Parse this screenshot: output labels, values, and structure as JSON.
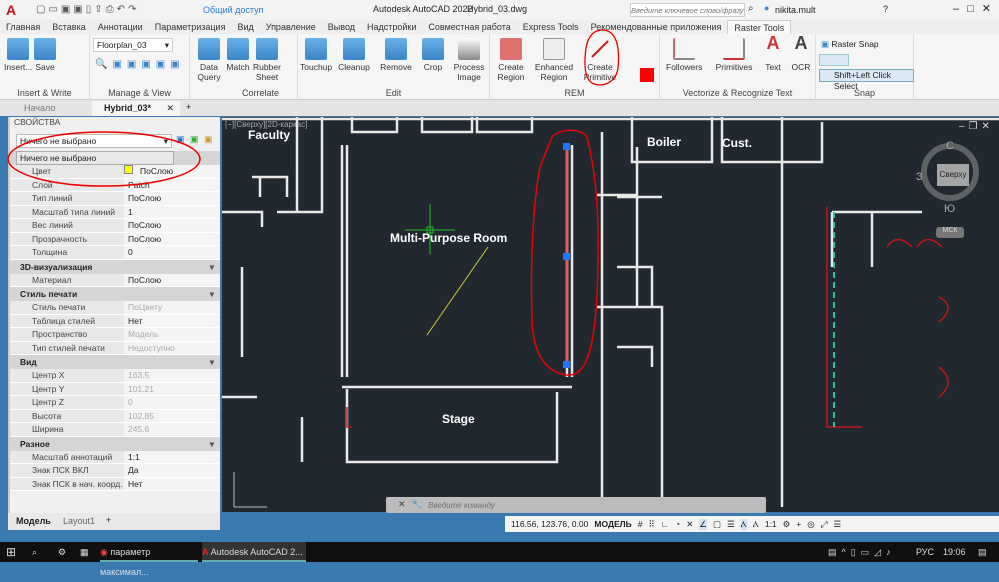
{
  "titlebar": {
    "app_title": "Autodesk AutoCAD 2022",
    "file": "Hybrid_03.dwg",
    "share": "Общий доступ",
    "search_placeholder": "Введите ключевое слово/фразу",
    "user": "nikita.mult"
  },
  "menu_tabs": [
    "Главная",
    "Вставка",
    "Аннотации",
    "Параметризация",
    "Вид",
    "Управление",
    "Вывод",
    "Надстройки",
    "Совместная работа",
    "Express Tools",
    "Рекомендованные приложения",
    "Raster Tools"
  ],
  "active_tab": "Raster Tools",
  "ribbon": {
    "insert_write": {
      "title": "Insert & Write",
      "insert": "Insert...",
      "save": "Save"
    },
    "manage_view": {
      "title": "Manage & View",
      "image_select": "Floorplan_03"
    },
    "data_query": "Data Query",
    "correlate": {
      "title": "Correlate",
      "match": "Match",
      "rubber_sheet": "Rubber Sheet"
    },
    "edit": {
      "title": "Edit",
      "touchup": "Touchup",
      "cleanup": "Cleanup",
      "remove": "Remove",
      "crop": "Crop",
      "process_image": "Process Image"
    },
    "rem": {
      "title": "REM",
      "create_region": "Create Region",
      "enhanced_region": "Enhanced Region",
      "create_primitive": "Create Primitive"
    },
    "vectorize": {
      "title": "Vectorize & Recognize Text",
      "followers": "Followers",
      "primitives": "Primitives",
      "text": "Text",
      "ocr": "OCR"
    },
    "snap": {
      "title": "Snap",
      "raster_snap": "Raster Snap",
      "shift_select": "Shift+Left Click Select"
    }
  },
  "doc_tabs": [
    "Начало",
    "Hybrid_03*"
  ],
  "properties": {
    "title": "СВОЙСТВА",
    "selection": "Ничего не выбрано",
    "dropdown_option": "Ничего не выбрано",
    "general": [
      {
        "k": "Цвет",
        "v": "ПоСлою"
      },
      {
        "k": "Слой",
        "v": "Patch"
      },
      {
        "k": "Тип линий",
        "v": "ПоСлою"
      },
      {
        "k": "Масштаб типа линий",
        "v": "1"
      },
      {
        "k": "Вес линий",
        "v": "ПоСлою"
      },
      {
        "k": "Прозрачность",
        "v": "ПоСлою"
      },
      {
        "k": "Толщина",
        "v": "0"
      }
    ],
    "viz_title": "3D-визуализация",
    "viz": [
      {
        "k": "Материал",
        "v": "ПоСлою"
      }
    ],
    "print_title": "Стиль печати",
    "print": [
      {
        "k": "Стиль печати",
        "v": "ПоЦвету"
      },
      {
        "k": "Таблица стилей печати",
        "v": "Нет"
      },
      {
        "k": "Пространство таблицы...",
        "v": "Модель"
      },
      {
        "k": "Тип стилей печати",
        "v": "Недоступно"
      }
    ],
    "view_title": "Вид",
    "view": [
      {
        "k": "Центр X",
        "v": "163.5"
      },
      {
        "k": "Центр Y",
        "v": "101.21"
      },
      {
        "k": "Центр Z",
        "v": "0"
      },
      {
        "k": "Высота",
        "v": "102.85"
      },
      {
        "k": "Ширина",
        "v": "245.6"
      }
    ],
    "misc_title": "Разное",
    "misc": [
      {
        "k": "Масштаб аннотаций",
        "v": "1:1"
      },
      {
        "k": "Знак ПСК ВКЛ",
        "v": "Да"
      },
      {
        "k": "Знак ПСК в нач. коорд.",
        "v": "Нет"
      }
    ]
  },
  "canvas": {
    "viewport_label": "[−][Сверху][2D-каркас]",
    "rooms": [
      "Faculty",
      "Boiler",
      "Cust.",
      "Multi-Purpose Room",
      "Stage"
    ],
    "viewcube": {
      "top": "Сверху",
      "n": "С",
      "s": "Ю",
      "w": "З",
      "wcs": "МСК"
    },
    "colors": {
      "bg": "#212830",
      "annotation": "#e01010",
      "grip": "#1e78ff"
    }
  },
  "layout_tabs": [
    "Модель",
    "Layout1"
  ],
  "command": {
    "placeholder": "Введите команду"
  },
  "status": {
    "coords": "116.56, 123.76, 0.00",
    "mode": "МОДЕЛЬ",
    "scale": "1:1"
  },
  "taskbar": {
    "chrome": "параметр максимал...",
    "autocad": "Autodesk AutoCAD 2...",
    "lang": "РУС",
    "time": "19:06"
  }
}
